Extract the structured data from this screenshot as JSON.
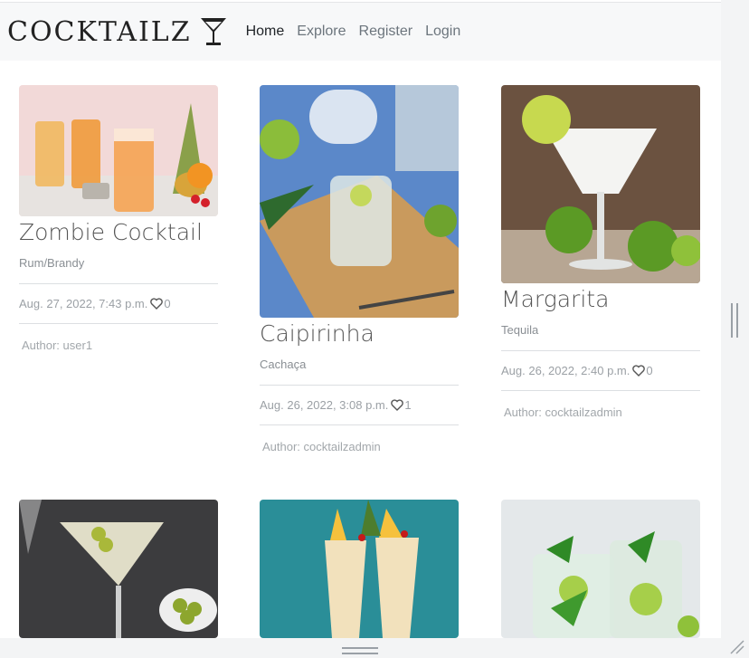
{
  "navbar": {
    "brand": "COCKTAILZ",
    "brand_icon": "martini-glass-icon",
    "links": [
      {
        "label": "Home",
        "active": true
      },
      {
        "label": "Explore",
        "active": false
      },
      {
        "label": "Register",
        "active": false
      },
      {
        "label": "Login",
        "active": false
      }
    ]
  },
  "cards": [
    {
      "title": "Zombie Cocktail",
      "spirit": "Rum/Brandy",
      "date": "Aug. 27, 2022, 7:43 p.m.",
      "likes": "0",
      "author": "Author: user1"
    },
    {
      "title": "Caipirinha",
      "spirit": "Cachaça",
      "date": "Aug. 26, 2022, 3:08 p.m.",
      "likes": "1",
      "author": "Author: cocktailzadmin"
    },
    {
      "title": "Margarita",
      "spirit": "Tequila",
      "date": "Aug. 26, 2022, 2:40 p.m.",
      "likes": "0",
      "author": "Author: cocktailzadmin"
    },
    {
      "image": "martini-photo"
    },
    {
      "image": "pina-colada-photo"
    },
    {
      "image": "mojito-photo"
    }
  ],
  "colors": {
    "navbar_bg": "#f7f8f9",
    "text_muted": "#8a8f94",
    "title": "#555555"
  }
}
